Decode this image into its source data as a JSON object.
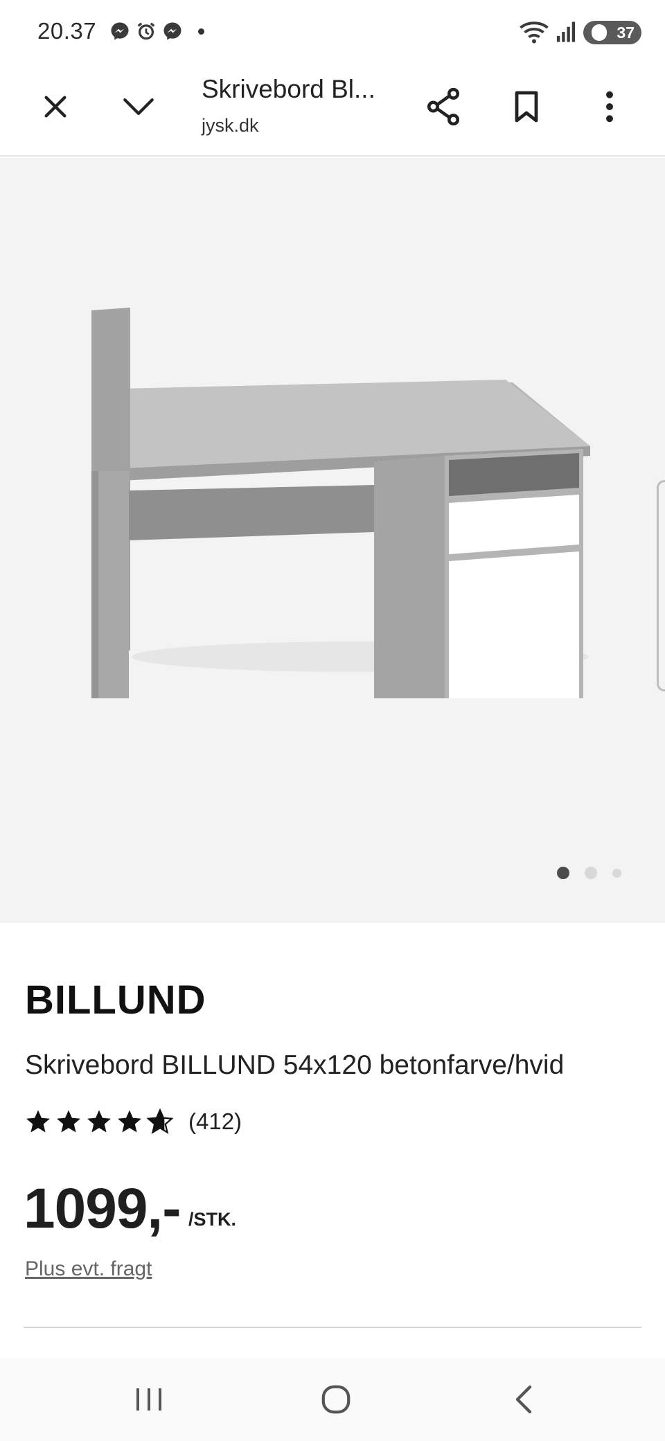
{
  "status_bar": {
    "time": "20.37",
    "battery": "37",
    "icons": [
      "messenger-icon",
      "alarm-icon",
      "messenger-icon",
      "dot-icon",
      "wifi-icon",
      "signal-icon",
      "battery-icon"
    ]
  },
  "toolbar": {
    "page_title": "Skrivebord Bl...",
    "domain": "jysk.dk",
    "icons": [
      "close-icon",
      "chevron-down-icon",
      "share-icon",
      "bookmark-icon",
      "more-vert-icon"
    ]
  },
  "gallery": {
    "image_count": 3,
    "active_index": 0
  },
  "product": {
    "brand": "BILLUND",
    "name": "Skrivebord BILLUND 54x120 betonfarve/hvid",
    "rating": 4.6,
    "review_count": "(412)",
    "price": "1099,-",
    "unit": "/STK.",
    "shipping_note": "Plus evt. fragt"
  },
  "navbar": {
    "icons": [
      "recents-icon",
      "home-icon",
      "back-icon"
    ]
  },
  "colors": {
    "text": "#1a1a1a",
    "gallery_bg": "#f3f3f3",
    "muted": "#666666"
  }
}
